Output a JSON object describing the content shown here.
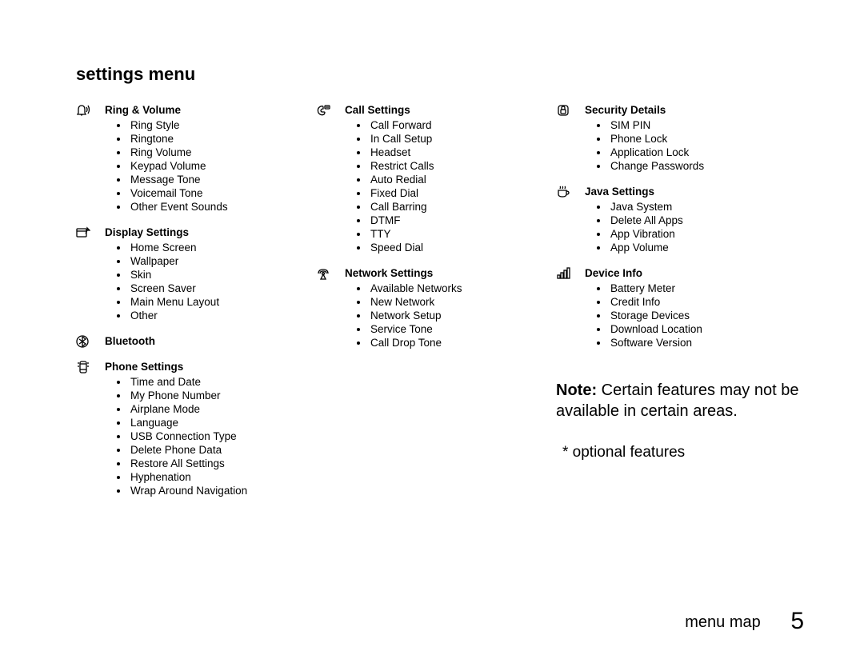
{
  "title": "settings menu",
  "columns": [
    {
      "sections": [
        {
          "icon": "ring-volume-icon",
          "label": "Ring & Volume",
          "items": [
            "Ring Style",
            "Ringtone",
            "Ring Volume",
            "Keypad Volume",
            "Message Tone",
            "Voicemail Tone",
            "Other Event Sounds"
          ]
        },
        {
          "icon": "display-settings-icon",
          "label": "Display Settings",
          "items": [
            "Home Screen",
            "Wallpaper",
            "Skin",
            "Screen Saver",
            "Main Menu Layout",
            "Other"
          ]
        },
        {
          "icon": "bluetooth-icon",
          "label": "Bluetooth",
          "items": []
        },
        {
          "icon": "phone-settings-icon",
          "label": "Phone Settings",
          "items": [
            "Time and Date",
            "My Phone Number",
            "Airplane Mode",
            "Language",
            "USB Connection Type",
            "Delete Phone Data",
            "Restore All Settings",
            "Hyphenation",
            "Wrap Around Navigation"
          ]
        }
      ]
    },
    {
      "sections": [
        {
          "icon": "call-settings-icon",
          "label": "Call Settings",
          "items": [
            "Call Forward",
            "In Call Setup",
            "Headset",
            "Restrict Calls",
            "Auto Redial",
            "Fixed Dial",
            "Call Barring",
            "DTMF",
            "TTY",
            "Speed Dial"
          ]
        },
        {
          "icon": "network-settings-icon",
          "label": "Network Settings",
          "items": [
            "Available Networks",
            "New Network",
            "Network Setup",
            "Service Tone",
            "Call Drop Tone"
          ]
        }
      ]
    },
    {
      "sections": [
        {
          "icon": "security-details-icon",
          "label": "Security Details",
          "items": [
            "SIM PIN",
            "Phone Lock",
            "Application Lock",
            "Change Passwords"
          ]
        },
        {
          "icon": "java-settings-icon",
          "label": "Java Settings",
          "items": [
            "Java System",
            "Delete All Apps",
            "App Vibration",
            "App Volume"
          ]
        },
        {
          "icon": "device-info-icon",
          "label": "Device Info",
          "items": [
            "Battery Meter",
            "Credit Info",
            "Storage Devices",
            "Download Location",
            "Software Version"
          ]
        }
      ],
      "note_prefix": "Note:",
      "note_body": "Certain features may not be available in certain areas.",
      "optional": "* optional features"
    }
  ],
  "footer_label": "menu map",
  "footer_page": "5",
  "icons_svg": {
    "ring-volume-icon": "<svg viewBox='0 0 18 16'><path d='M7 2 Q3 2 3 7 L3 11 L2 13 L12 13 L11 11 L11 7 Q11 2 7 2 Z'/><path d='M6 13 Q7 15 8 13'/><path d='M13 4 Q15 7 13 10' stroke-width='1'/><path d='M15 2 Q18 7 15 12' stroke-width='1'/></svg>",
    "display-settings-icon": "<svg viewBox='0 0 18 16'><rect x='1' y='3' width='12' height='10' rx='1'/><line x1='1' y1='6' x2='13' y2='6'/><path d='M14 2 L17 5 L14 5 Z' fill='#000'/><path d='M14 5 L12 9'/></svg>",
    "bluetooth-icon": "<svg viewBox='0 0 18 16'><circle cx='8' cy='8' r='7' fill='#000' stroke='none'/><path d='M8 2 L8 14 L12 11 L4 5 M8 2 L12 5 L4 11' stroke='#fff' stroke-width='1.2' fill='none'/></svg>",
    "phone-settings-icon": "<svg viewBox='0 0 18 16'><rect x='5' y='1' width='8' height='14' rx='2'/><line x1='5' y1='4' x2='13' y2='4'/><line x1='5' y1='11' x2='13' y2='11'/><line x1='2' y1='3' x2='4' y2='3'/><line x1='2' y1='7' x2='4' y2='7'/><line x1='14' y1='3' x2='16' y2='3'/><line x1='14' y1='7' x2='16' y2='7'/></svg>",
    "call-settings-icon": "<svg viewBox='0 0 18 16'><path d='M3 11 Q1 5 6 3 Q9 2 9 4 L9 6 Q7 6 6 8 Q6 10 8 10 L10 10 Q12 10 10 13 Q6 15 3 11 Z'/><rect x='11' y='2' width='6' height='4' rx='1'/><line x1='12' y1='4' x2='16' y2='4'/></svg>",
    "network-settings-icon": "<svg viewBox='0 0 18 16'><path d='M3 8 Q3 3 9 3 Q15 3 15 8' /><circle cx='9' cy='8' r='1.5' fill='#000' stroke='none'/><path d='M9 9 L6 15 L12 15 Z' fill='#000' stroke='none'/><path d='M5 8 Q5 5 9 5 Q13 5 13 8'/></svg>",
    "security-details-icon": "<svg viewBox='0 0 18 16'><rect x='3' y='2' width='12' height='12' rx='3'/><path d='M7 5 Q7 3 9 3 Q11 3 11 5 L11 7 L7 7 Z'/><rect x='6' y='7' width='6' height='5' rx='1'/></svg>",
    "java-settings-icon": "<svg viewBox='0 0 18 16'><path d='M3 6 L3 11 Q3 14 8 14 Q13 14 13 11 L13 6 Z'/><path d='M13 7 Q16 7 16 9 Q16 11 13 11'/><path d='M5 4 Q6 2 5 1' /><path d='M8 4 Q9 2 8 1'/><path d='M11 4 Q12 2 11 1'/></svg>",
    "device-info-icon": "<svg viewBox='0 0 18 16'><rect x='2' y='10' width='3' height='4' fill='#000' stroke='none'/><rect x='6' y='7' width='3' height='7' fill='#000' stroke='none'/><rect x='10' y='4' width='3' height='10' fill='#000' stroke='none'/><rect x='14' y='1' width='3' height='13' fill='#000' stroke='none'/></svg>"
  }
}
